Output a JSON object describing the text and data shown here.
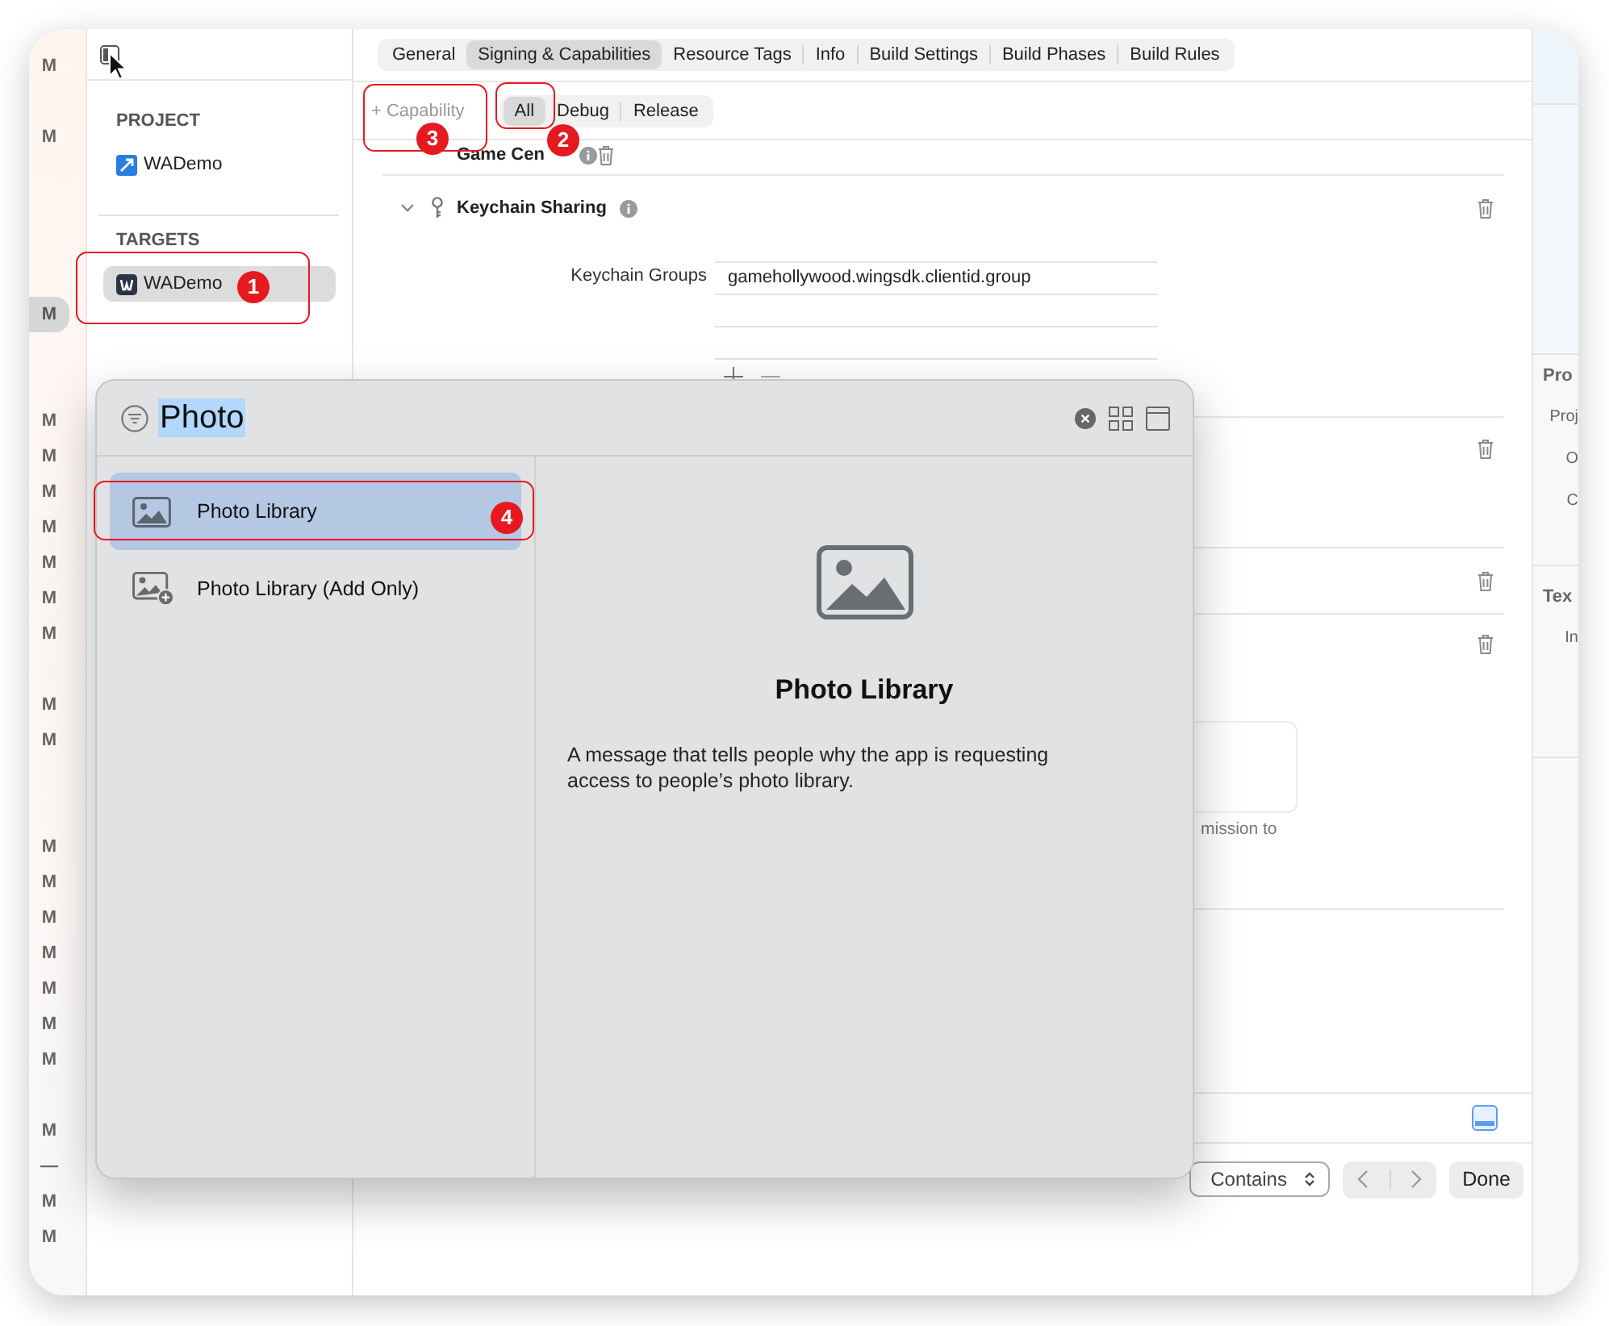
{
  "gutter": {
    "marks": [
      {
        "text": "M",
        "selected": false
      },
      {
        "text": "M",
        "selected": false
      },
      {
        "text": "M",
        "selected": true
      },
      {
        "text": "M",
        "selected": false
      },
      {
        "text": "M",
        "selected": false
      },
      {
        "text": "M",
        "selected": false
      },
      {
        "text": "M",
        "selected": false
      },
      {
        "text": "M",
        "selected": false
      },
      {
        "text": "M",
        "selected": false
      },
      {
        "text": "M",
        "selected": false
      },
      {
        "text": "M",
        "selected": false
      },
      {
        "text": "M",
        "selected": false
      },
      {
        "text": "M",
        "selected": false
      },
      {
        "text": "M",
        "selected": false
      },
      {
        "text": "M",
        "selected": false
      },
      {
        "text": "M",
        "selected": false
      },
      {
        "text": "M",
        "selected": false
      },
      {
        "text": "M",
        "selected": false
      },
      {
        "text": "M",
        "selected": false
      },
      {
        "text": "M",
        "selected": false
      },
      {
        "text": "—",
        "selected": false
      },
      {
        "text": "M",
        "selected": false
      },
      {
        "text": "M",
        "selected": false
      }
    ]
  },
  "navigator": {
    "sections": [
      {
        "title": "PROJECT",
        "items": [
          {
            "label": "WADemo",
            "kind": "project",
            "selected": false
          }
        ]
      },
      {
        "title": "TARGETS",
        "items": [
          {
            "label": "WADemo",
            "kind": "target",
            "selected": true
          }
        ]
      }
    ]
  },
  "tabs": [
    {
      "label": "General",
      "selected": false
    },
    {
      "label": "Signing & Capabilities",
      "selected": true
    },
    {
      "label": "Resource Tags",
      "selected": false
    },
    {
      "label": "Info",
      "selected": false
    },
    {
      "label": "Build Settings",
      "selected": false
    },
    {
      "label": "Build Phases",
      "selected": false
    },
    {
      "label": "Build Rules",
      "selected": false
    }
  ],
  "capability_bar": {
    "add_label": "+ Capability",
    "filters": [
      {
        "label": "All",
        "selected": true
      },
      {
        "label": "Debug",
        "selected": false
      },
      {
        "label": "Release",
        "selected": false
      }
    ]
  },
  "capabilities": [
    {
      "kind": "partial",
      "name": "Game Cen"
    },
    {
      "kind": "keychain",
      "name": "Keychain Sharing",
      "expanded": true,
      "field_label": "Keychain Groups",
      "groups": [
        "gamehollywood.wingsdk.clientid.group"
      ]
    },
    {
      "kind": "hidden"
    },
    {
      "kind": "hidden"
    },
    {
      "kind": "usage",
      "note": "mission to"
    }
  ],
  "inspector": {
    "groups": [
      {
        "heading": "Pro",
        "labels": [
          "Proj",
          "O",
          "C"
        ]
      },
      {
        "heading": "Tex",
        "labels": [
          "In"
        ]
      }
    ]
  },
  "find_bar": {
    "mode": "Contains",
    "done": "Done"
  },
  "popup": {
    "query": "Photo",
    "items": [
      {
        "label": "Photo Library",
        "kind": "library",
        "selected": true
      },
      {
        "label": "Photo Library (Add Only)",
        "kind": "add_only",
        "selected": false
      }
    ],
    "detail": {
      "title": "Photo Library",
      "description": "A message that tells people why the app is requesting access to people’s photo library."
    }
  },
  "annotations": [
    {
      "number": "1"
    },
    {
      "number": "2"
    },
    {
      "number": "3"
    },
    {
      "number": "4"
    }
  ]
}
